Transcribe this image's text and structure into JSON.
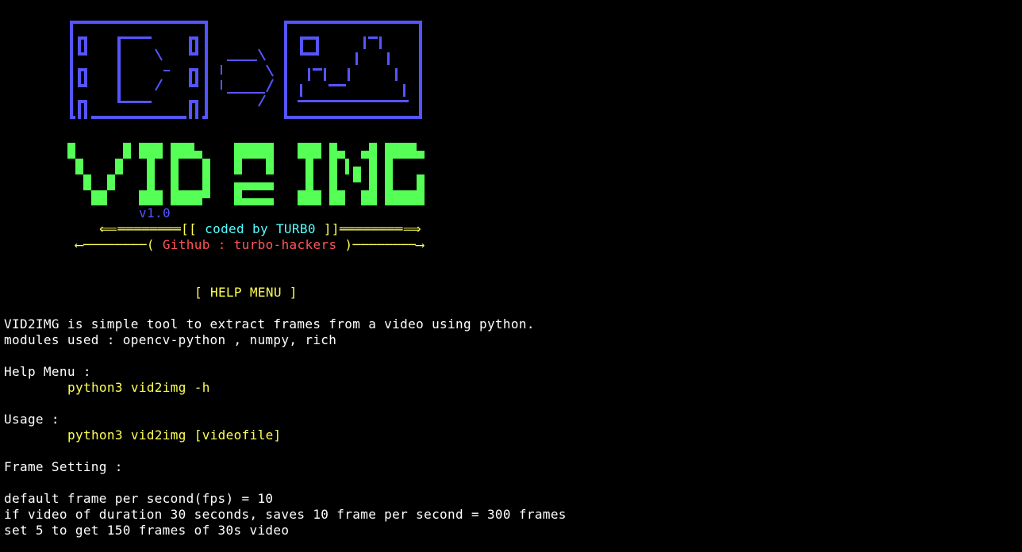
{
  "banner": {
    "version": "v1.0",
    "credit": {
      "left_bracket": "[[ ",
      "text": "coded by TURB0",
      "right_bracket": " ]]"
    },
    "github": {
      "open": "( ",
      "text": "Github : turbo-hackers",
      "close": " )"
    },
    "colors": {
      "frame_blue": "#5555ff",
      "title_green": "#55ff55",
      "accent_yellow": "#ffff55",
      "accent_cyan": "#55ffff",
      "accent_red": "#ff5555"
    }
  },
  "help": {
    "title": "[ HELP MENU ]",
    "intro_1": "VID2IMG is simple tool to extract frames from a video using python.",
    "intro_2": "modules used : opencv-python , numpy, rich",
    "help_menu_label": "Help Menu :",
    "help_menu_cmd": "python3 vid2img -h",
    "usage_label": "Usage :",
    "usage_cmd": "python3 vid2img [videofile]",
    "frame_setting_label": "Frame Setting :",
    "fps_line": "default frame per second(fps) = 10",
    "example_line": "if video of duration 30 seconds, saves 10 frame per second = 300 frames",
    "set_line": "set 5 to get 150 frames of 30s video"
  }
}
